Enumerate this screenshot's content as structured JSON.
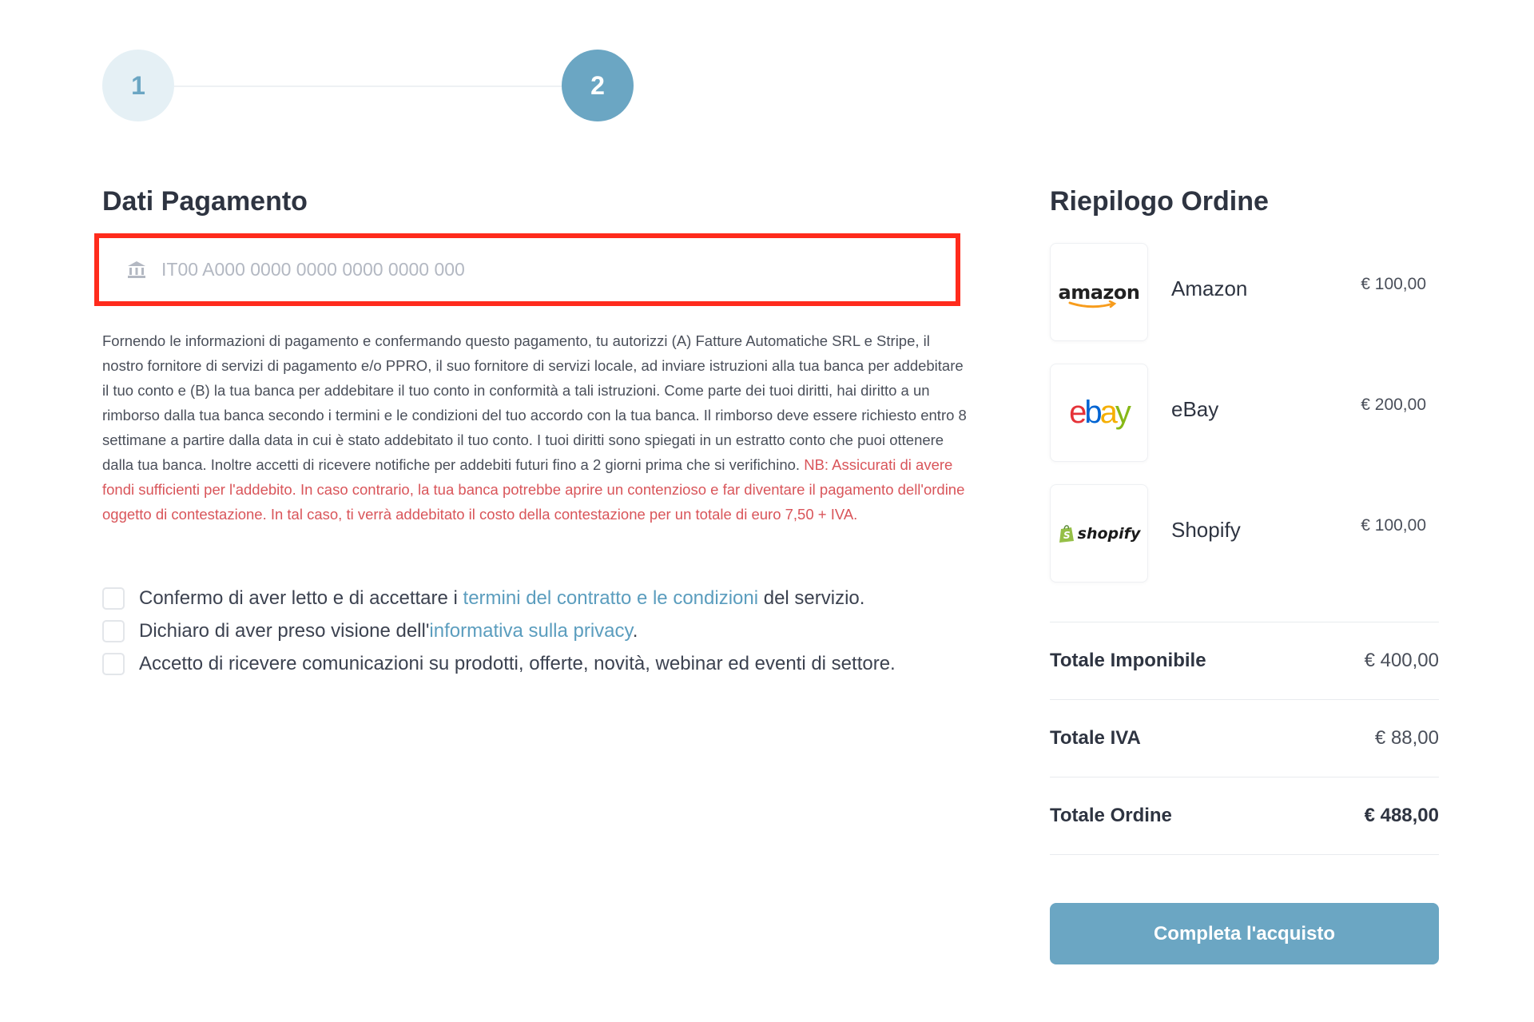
{
  "stepper": {
    "step1": "1",
    "step2": "2"
  },
  "payment": {
    "title": "Dati Pagamento",
    "iban_placeholder": "IT00 A000 0000 0000 0000 0000 000",
    "iban_value": "",
    "mandate_text": "Fornendo le informazioni di pagamento e confermando questo pagamento, tu autorizzi (A) Fatture Automatiche SRL e Stripe, il nostro fornitore di servizi di pagamento e/o PPRO, il suo fornitore di servizi locale, ad inviare istruzioni alla tua banca per addebitare il tuo conto e (B) la tua banca per addebitare il tuo conto in conformità a tali istruzioni. Come parte dei tuoi diritti, hai diritto a un rimborso dalla tua banca secondo i termini e le condizioni del tuo accordo con la tua banca. Il rimborso deve essere richiesto entro 8 settimane a partire dalla data in cui è stato addebitato il tuo conto. I tuoi diritti sono spiegati in un estratto conto che puoi ottenere dalla tua banca. Inoltre accetti di ricevere notifiche per addebiti futuri fino a 2 giorni prima che si verifichino. ",
    "mandate_warning": "NB: Assicurati di avere fondi sufficienti per l'addebito. In caso contrario, la tua banca potrebbe aprire un contenzioso e far diventare il pagamento dell'ordine oggetto di contestazione. In tal caso, ti verrà addebitato il costo della contestazione per un totale di euro 7,50 + IVA."
  },
  "consents": [
    {
      "before": "Confermo di aver letto e di accettare i ",
      "link": "termini del contratto e le condizioni",
      "after": " del servizio."
    },
    {
      "before": "Dichiaro di aver preso visione dell'",
      "link": "informativa sulla privacy",
      "after": "."
    },
    {
      "before": "Accetto di ricevere comunicazioni su prodotti, offerte, novità, webinar ed eventi di settore.",
      "link": "",
      "after": ""
    }
  ],
  "summary": {
    "title": "Riepilogo Ordine",
    "items": [
      {
        "name": "Amazon",
        "price": "€ 100,00",
        "logo_text": "amazon",
        "icon": "amazon-logo"
      },
      {
        "name": "eBay",
        "price": "€ 200,00",
        "logo_text": "ebay",
        "icon": "ebay-logo"
      },
      {
        "name": "Shopify",
        "price": "€ 100,00",
        "logo_text": "shopify",
        "icon": "shopify-logo"
      }
    ],
    "totals": [
      {
        "label": "Totale Imponibile",
        "value": "€ 400,00"
      },
      {
        "label": "Totale IVA",
        "value": "€ 88,00"
      },
      {
        "label": "Totale Ordine",
        "value": "€ 488,00"
      }
    ],
    "cta_label": "Completa l'acquisto"
  },
  "colors": {
    "accent": "#6ba6c3",
    "highlight_border": "#ff2b1c",
    "warning_text": "#d9555a",
    "link": "#5b9dbe"
  }
}
